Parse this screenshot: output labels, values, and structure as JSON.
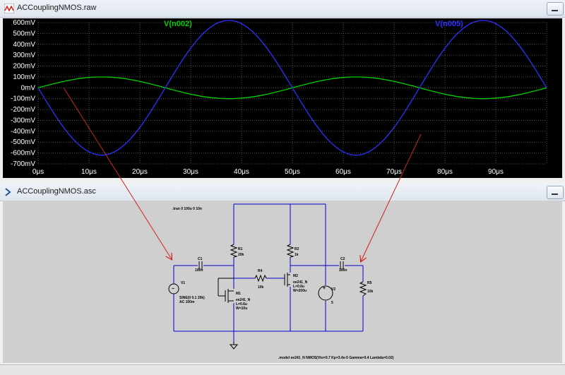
{
  "plot_window": {
    "title": "ACCouplingNMOS.raw",
    "trace_labels": [
      {
        "name": "V(n002)",
        "color": "#00d000"
      },
      {
        "name": "V(n005)",
        "color": "#3030ff"
      }
    ]
  },
  "chart_data": {
    "type": "line",
    "x_label_unit": "μs",
    "x_ticks": [
      "0μs",
      "10μs",
      "20μs",
      "30μs",
      "40μs",
      "50μs",
      "60μs",
      "70μs",
      "80μs",
      "90μs"
    ],
    "y_ticks": [
      "600mV",
      "500mV",
      "400mV",
      "300mV",
      "200mV",
      "100mV",
      "0mV",
      "-100mV",
      "-200mV",
      "-300mV",
      "-400mV",
      "-500mV",
      "-600mV",
      "-700mV"
    ],
    "xlim": [
      0,
      100
    ],
    "ylim": [
      -700,
      600
    ],
    "grid": true,
    "series": [
      {
        "name": "V(n002)",
        "color": "#00d000",
        "amplitude_mV": 100,
        "freq_kHz": 20,
        "phase": "sine"
      },
      {
        "name": "V(n005)",
        "color": "#3030ff",
        "amplitude_mV": 620,
        "freq_kHz": 20,
        "phase": "inverted"
      }
    ]
  },
  "schematic_window": {
    "title": "ACCouplingNMOS.asc",
    "directive": ".tran 0 100u 0 10n",
    "model_line": ".model ee241_N NMOS(Vto=0.7 Kp=3.4e-5 Gamma=0.4 Lambda=0.02)",
    "labels": {
      "c1": "C1",
      "c1v": "100n",
      "c2": "C2",
      "c2v": "100n",
      "r1": "R1",
      "r1v": "20k",
      "r2": "R2",
      "r2v": "1k",
      "r4": "R4",
      "r4v": "10k",
      "r5": "R5",
      "r5v": "10k",
      "m1": "M1",
      "m1model": "ee241_N",
      "m1l": "L=0.6u",
      "m1w": "W=10u",
      "m2": "M2",
      "m2model": "ee241_N",
      "m2l": "L=0.6u",
      "m2w": "W=200u",
      "v1": "V1",
      "v1v": "SINE(0 0.1 20k)",
      "v1ac": "AC 100m",
      "v2": "V2",
      "v2v": "5"
    }
  },
  "colors": {
    "wire": "#0000cc",
    "annotation_arrow": "#cc2222",
    "plot_bg": "#000000",
    "schematic_bg": "#cfcfcf"
  }
}
